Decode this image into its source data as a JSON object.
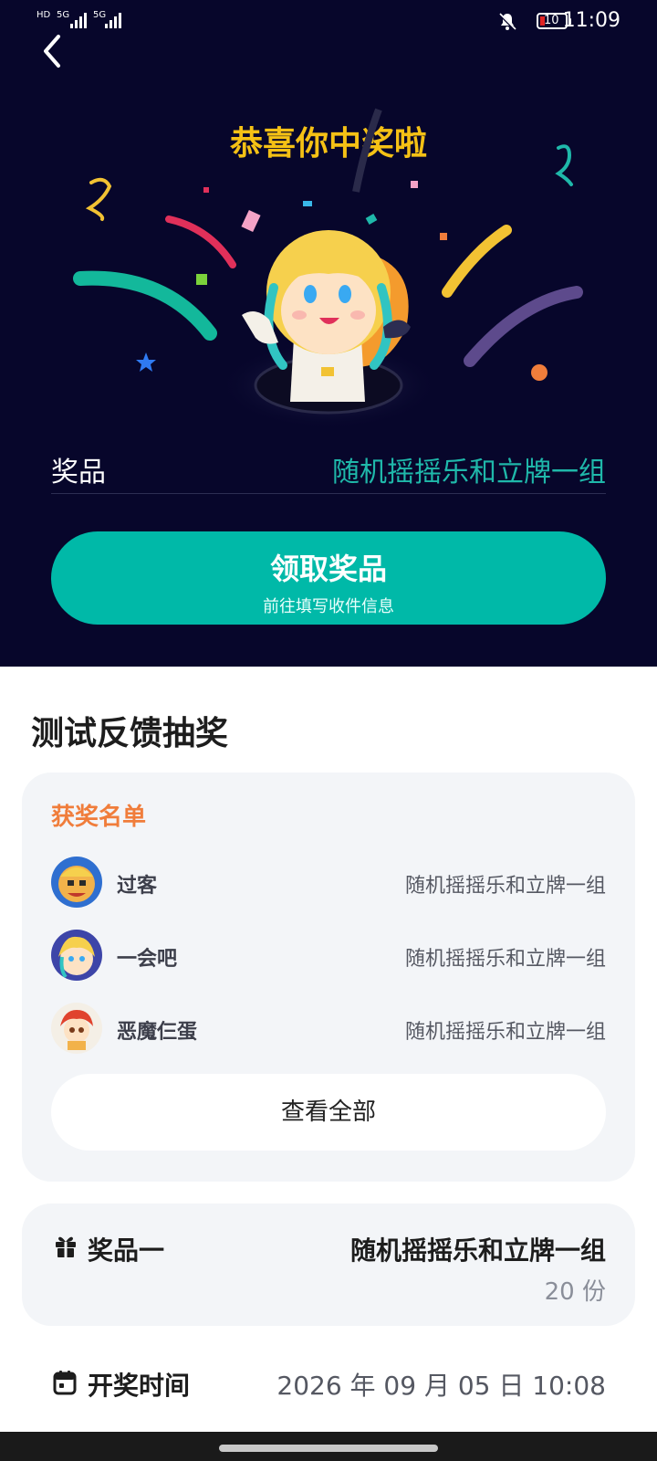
{
  "status_bar": {
    "time": "11:09",
    "signal_1": "5G",
    "signal_2": "5G",
    "battery": "10",
    "icons": [
      "hd-icon",
      "signal-icon",
      "mute-bell-icon",
      "battery-icon"
    ]
  },
  "hero": {
    "title": "恭喜你中奖啦",
    "prize_label": "奖品",
    "prize_value": "随机摇摇乐和立牌一组",
    "claim_button": "领取奖品",
    "claim_sub": "前往填写收件信息",
    "colors": {
      "background": "#07062b",
      "title": "#f5c115",
      "accent": "#00b9a8"
    }
  },
  "main": {
    "section_title": "测试反馈抽奖",
    "winners_title": "获奖名单",
    "winners": [
      {
        "name": "过客",
        "prize": "随机摇摇乐和立牌一组"
      },
      {
        "name": "一会吧",
        "prize": "随机摇摇乐和立牌一组"
      },
      {
        "name": "恶魔仨蛋",
        "prize": "随机摇摇乐和立牌一组"
      }
    ],
    "view_all": "查看全部",
    "prize_card": {
      "label": "奖品一",
      "value": "随机摇摇乐和立牌一组",
      "count": "20 份"
    },
    "draw_time": {
      "label": "开奖时间",
      "value": "2026 年 09 月 05 日 10:08"
    }
  }
}
